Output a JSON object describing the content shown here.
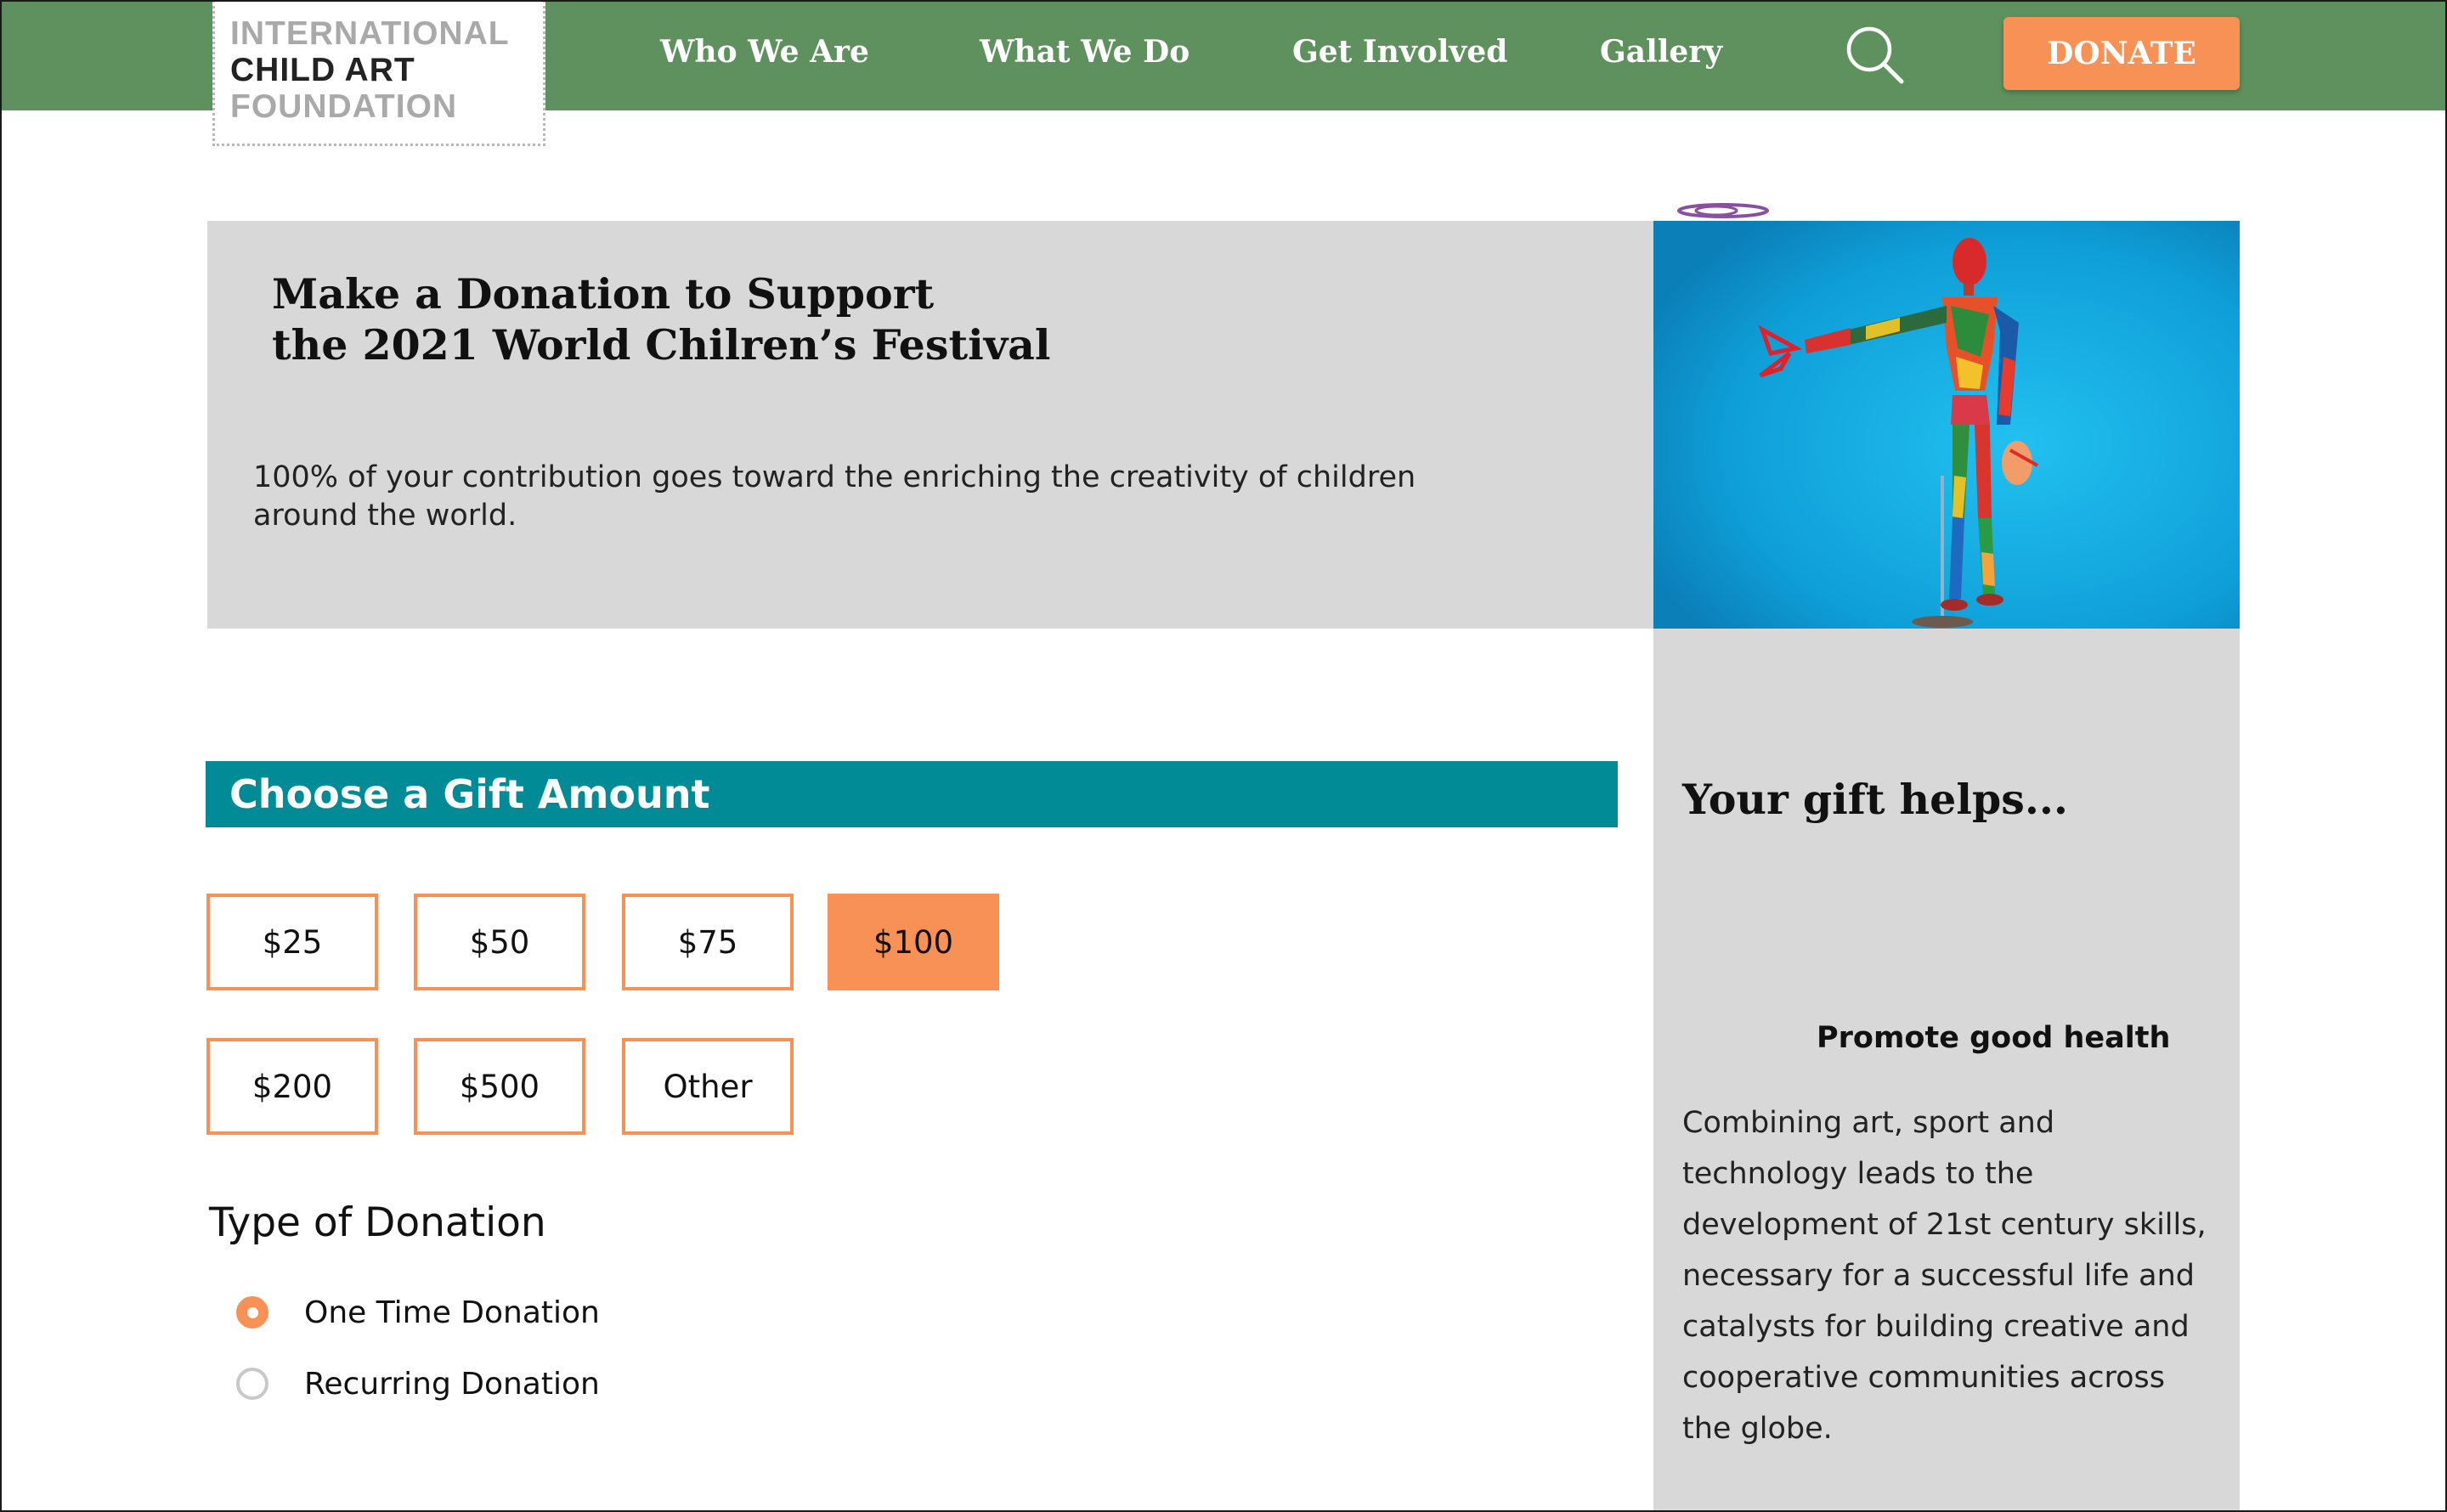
{
  "logo": {
    "line1": "INTERNATIONAL",
    "line2": "CHILD ART",
    "line3": "FOUNDATION"
  },
  "nav": {
    "items": [
      {
        "label": "Who We Are"
      },
      {
        "label": "What We Do"
      },
      {
        "label": "Get Involved"
      },
      {
        "label": "Gallery"
      }
    ],
    "search_icon": "search-icon",
    "donate_label": "DONATE"
  },
  "hero": {
    "title_line1": "Make a Donation to Support",
    "title_line2": "the 2021 World Chilren’s Festival",
    "subtitle": "100% of your contribution goes toward the enriching the creativity of children around the world."
  },
  "side": {
    "title": "Your gift helps...",
    "subtitle": "Promote good health",
    "body": "Combining art, sport and technology leads to the development of 21st century skills, necessary for a successful life and catalysts for building creative and cooperative communities across the globe."
  },
  "gift": {
    "header": "Choose a Gift Amount",
    "amounts": [
      "$25",
      "$50",
      "$75",
      "$100",
      "$200",
      "$500",
      "Other"
    ],
    "selected": "$100"
  },
  "donation_type": {
    "title": "Type of Donation",
    "options": [
      {
        "label": "One Time Donation",
        "selected": true
      },
      {
        "label": "Recurring Donation",
        "selected": false
      }
    ]
  },
  "colors": {
    "nav_green": "#5e915e",
    "accent_orange": "#f89155",
    "teal": "#008b96",
    "panel_gray": "#d8d8d8",
    "sky_blue": "#12a9e0"
  }
}
